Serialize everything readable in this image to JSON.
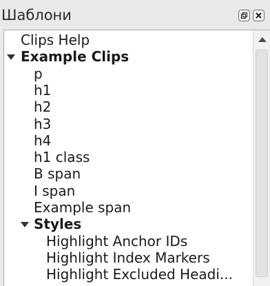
{
  "window": {
    "title": "Шаблони",
    "float_button": "float-icon",
    "close_button": "close-icon"
  },
  "tree": {
    "items": [
      {
        "label": "Clips Help",
        "level": 0,
        "bold": false
      },
      {
        "label": "Example Clips",
        "level": 0,
        "bold": true,
        "expanded": true
      },
      {
        "label": "p",
        "level": 1,
        "bold": false
      },
      {
        "label": "h1",
        "level": 1,
        "bold": false
      },
      {
        "label": "h2",
        "level": 1,
        "bold": false
      },
      {
        "label": "h3",
        "level": 1,
        "bold": false
      },
      {
        "label": "h4",
        "level": 1,
        "bold": false
      },
      {
        "label": "h1 class",
        "level": 1,
        "bold": false
      },
      {
        "label": "B span",
        "level": 1,
        "bold": false
      },
      {
        "label": "I span",
        "level": 1,
        "bold": false
      },
      {
        "label": "Example span",
        "level": 1,
        "bold": false
      },
      {
        "label": "Styles",
        "level": 1,
        "bold": true,
        "expanded": true
      },
      {
        "label": "Highlight Anchor IDs",
        "level": 2,
        "bold": false
      },
      {
        "label": "Highlight Index Markers",
        "level": 2,
        "bold": false
      },
      {
        "label": "Highlight Excluded Headi...",
        "level": 2,
        "bold": false
      }
    ]
  },
  "scrollbar": {
    "up_icon": "scroll-up-icon"
  }
}
